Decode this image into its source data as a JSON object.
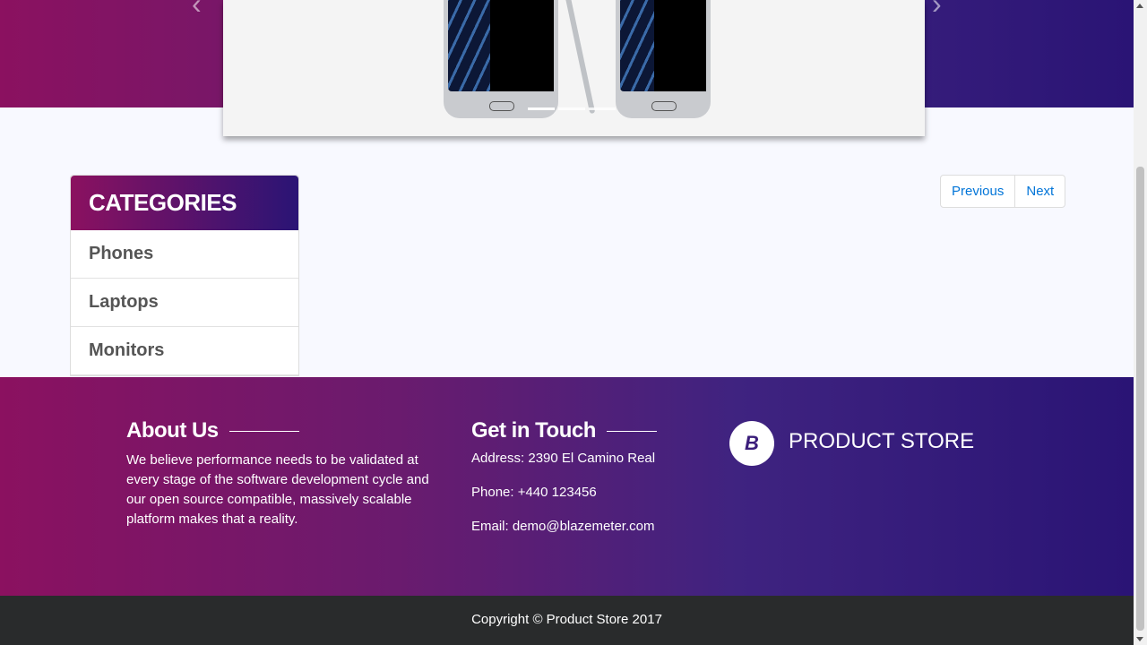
{
  "carousel": {
    "prev_icon": "chevron-left-icon",
    "next_icon": "chevron-right-icon",
    "indicator_count": 3
  },
  "categories": {
    "title": "CATEGORIES",
    "items": [
      {
        "label": "Phones"
      },
      {
        "label": "Laptops"
      },
      {
        "label": "Monitors"
      }
    ]
  },
  "pagination": {
    "previous_label": "Previous",
    "next_label": "Next"
  },
  "footer": {
    "about_title": "About Us",
    "about_text": "We believe performance needs to be validated at every stage of the software development cycle and our open source compatible, massively scalable platform makes that a reality.",
    "contact_title": "Get in Touch",
    "address": "Address: 2390 El Camino Real",
    "phone": "Phone: +440 123456",
    "email": "Email: demo@blazemeter.com",
    "logo_letter": "B",
    "brand_name": "PRODUCT STORE"
  },
  "copyright": "Copyright © Product Store 2017",
  "colors": {
    "gradient_start": "#8b1160",
    "gradient_end": "#2a1475",
    "link": "#0275d8",
    "dark_footer": "#292b2c"
  }
}
